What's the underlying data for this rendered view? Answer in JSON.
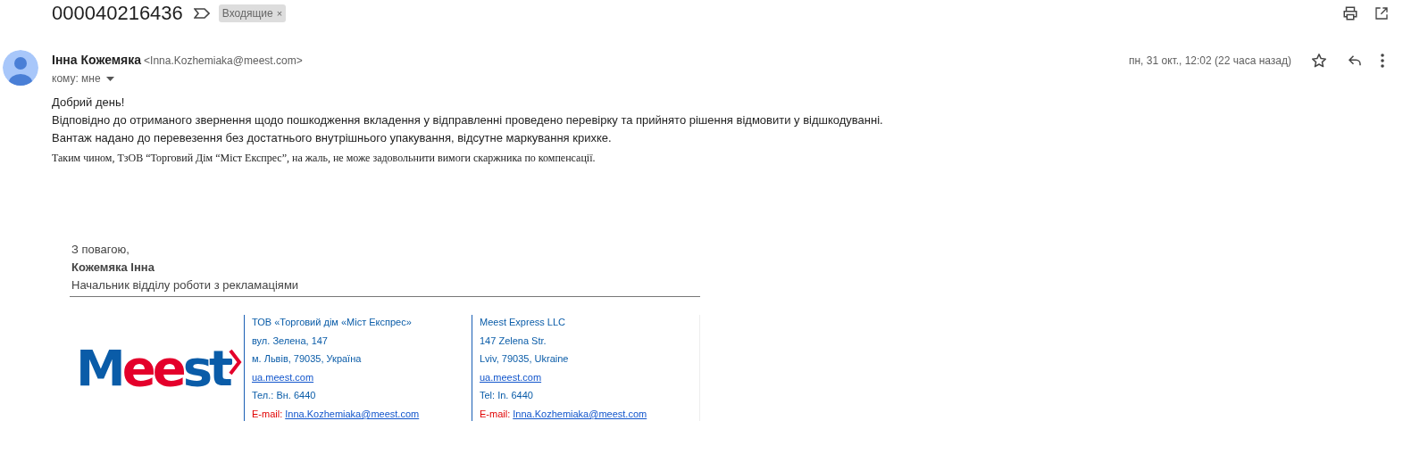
{
  "subject": "000040216436",
  "label": {
    "text": "Входящие",
    "close": "×"
  },
  "sender": {
    "name": "Інна Кожемяка",
    "email": "<Inna.Kozhemiaka@meest.com>",
    "to": "кому: мне"
  },
  "date": "пн, 31 окт., 12:02 (22 часа назад)",
  "starred": false,
  "body": [
    {
      "kind": "sans",
      "text": "Добрий день!"
    },
    {
      "kind": "sans",
      "text": "Відповідно до отриманого звернення щодо пошкодження вкладення у відправленні проведено перевірку та прийнято рішення відмовити у відшкодуванні."
    },
    {
      "kind": "sans",
      "text": "Вантаж надано до перевезення без достатнього внутрішнього упакування, відсутне маркування крихке."
    },
    {
      "kind": "serif",
      "text": "Таким чином, ТзОВ “Торговий Дім “Міст Експрес”, на жаль, не може задовольнити вимоги  скаржника по компенсації."
    }
  ],
  "signature": {
    "greeting": "З повагою,",
    "name": "Кожемяка Інна",
    "position": "Начальник відділу роботи з рекламаціями",
    "logo": [
      {
        "text": "M",
        "color": "#0a5ca8"
      },
      {
        "text": "ee",
        "color": "#e4002b"
      },
      {
        "text": "st",
        "color": "#0a5ca8"
      }
    ],
    "columns": [
      [
        {
          "kind": "text",
          "text": "ТОВ «Торговий дім «Міст Експрес»"
        },
        {
          "kind": "text",
          "text": "вул. Зелена, 147"
        },
        {
          "kind": "text",
          "text": "м. Львів, 79035, Україна"
        },
        {
          "kind": "link",
          "text": "ua.meest.com"
        },
        {
          "kind": "text",
          "text": "Тел.: Вн. 6440"
        },
        {
          "kind": "email",
          "label": "E-mail:",
          "text": "Inna.Kozhemiaka@meest.com"
        }
      ],
      [
        {
          "kind": "text",
          "text": "Meest Express LLC"
        },
        {
          "kind": "text",
          "text": "147 Zelena Str."
        },
        {
          "kind": "text",
          "text": "Lviv, 79035, Ukraine"
        },
        {
          "kind": "link",
          "text": "ua.meest.com"
        },
        {
          "kind": "text",
          "text": "Tel: In. 6440"
        },
        {
          "kind": "email",
          "label": "E-mail:",
          "text": "Inna.Kozhemiaka@meest.com"
        }
      ]
    ]
  }
}
